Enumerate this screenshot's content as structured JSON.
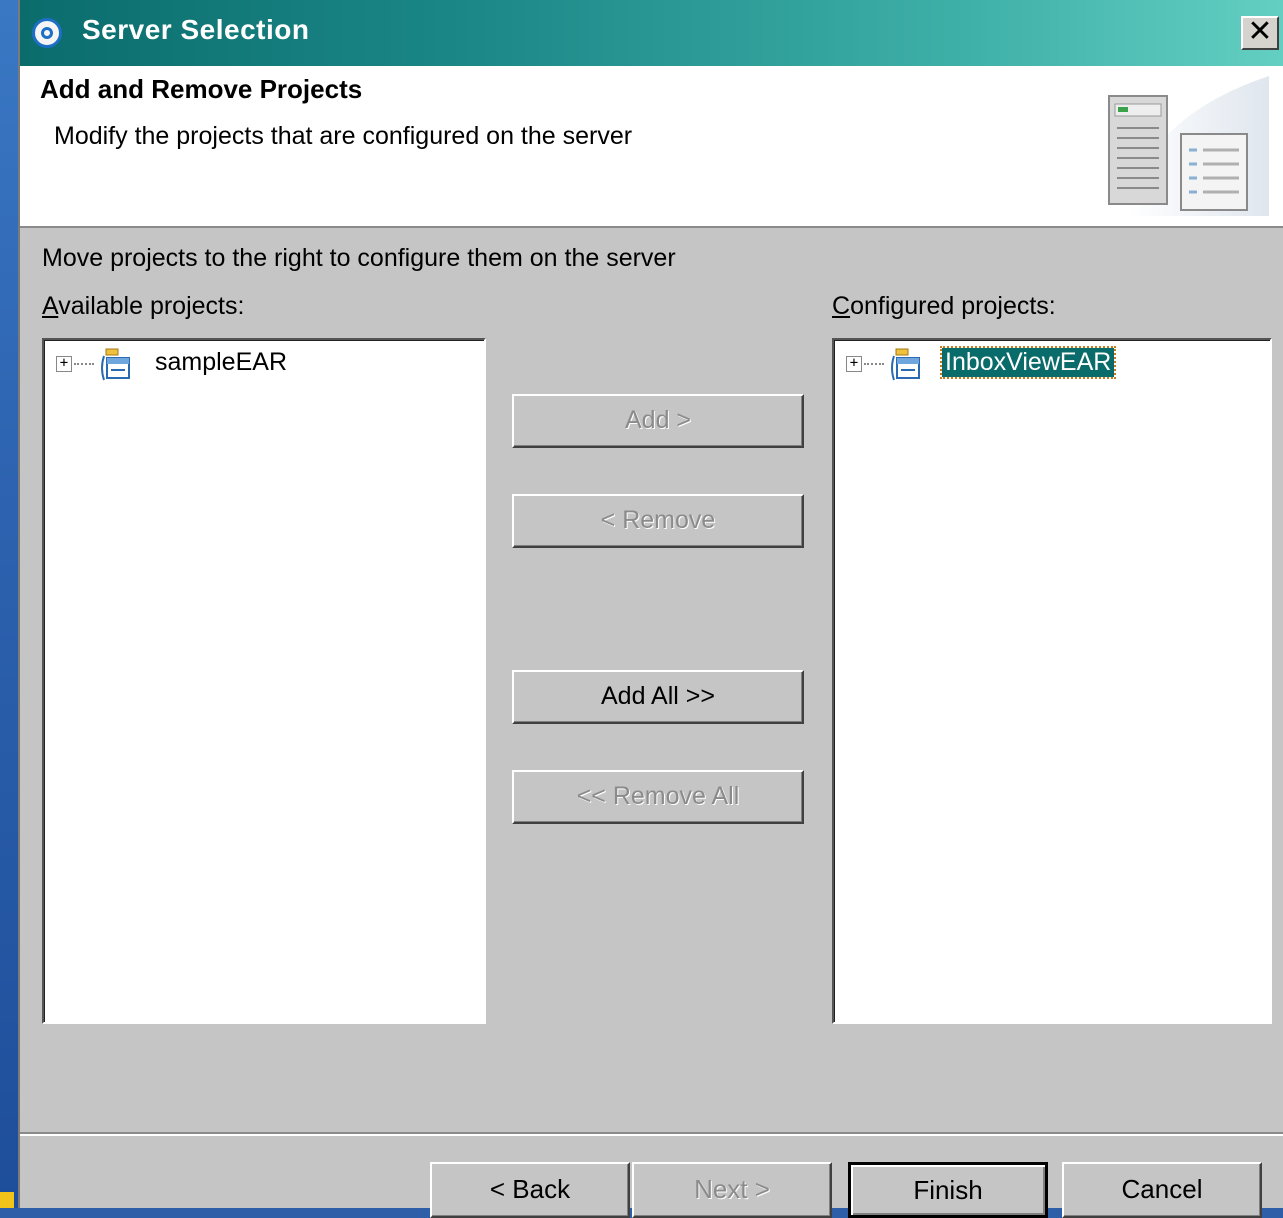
{
  "window": {
    "title": "Server Selection",
    "close_label": "✕"
  },
  "header": {
    "title": "Add and Remove Projects",
    "description": "Modify the projects that are configured on the server"
  },
  "instruction": "Move projects to the right to configure them on the server",
  "available": {
    "label_mnemonic": "A",
    "label_rest": "vailable projects:",
    "items": [
      {
        "expander": "+",
        "label": "sampleEAR",
        "icon": "ear-project-icon",
        "selected": false
      }
    ]
  },
  "configured": {
    "label_mnemonic": "C",
    "label_rest": "onfigured projects:",
    "items": [
      {
        "expander": "+",
        "label": "InboxViewEAR",
        "icon": "ear-project-icon",
        "selected": true
      }
    ]
  },
  "buttons": {
    "add": {
      "label": "Add >",
      "enabled": false
    },
    "remove": {
      "label": "< Remove",
      "enabled": false
    },
    "add_all": {
      "label": "Add All >>",
      "enabled": true
    },
    "remove_all": {
      "label": "<< Remove All",
      "enabled": false
    }
  },
  "footer": {
    "back": {
      "label": "< Back",
      "enabled": true
    },
    "next": {
      "label": "Next >",
      "enabled": false
    },
    "finish": {
      "label": "Finish",
      "enabled": true,
      "default": true
    },
    "cancel": {
      "label": "Cancel",
      "enabled": true
    }
  },
  "colors": {
    "titlebar_start": "#0b6c6c",
    "titlebar_end": "#63cfc2",
    "selection": "#0a6b6b",
    "dialog_bg": "#c5c5c5"
  }
}
